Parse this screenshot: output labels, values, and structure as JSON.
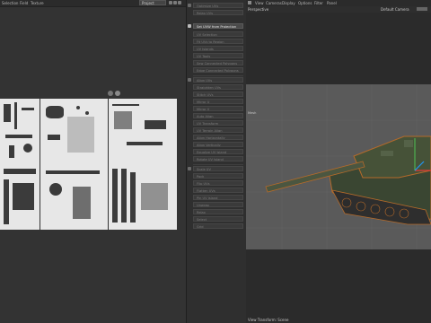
{
  "uv_editor": {
    "menu": [
      "Selection",
      "Field",
      "Texture"
    ],
    "mode_select": "Project"
  },
  "commands": {
    "items": [
      "Optimize UVs",
      "Relax UVs",
      "Set UVW from Projection",
      "UV Selection",
      "Fit UVs to Region",
      "UV Islands",
      "UV Tools",
      "Sew Connected Polygons",
      "Edge Connected Polygons",
      "Align UVs",
      "Straighten UVs",
      "Stitch UVs",
      "Mirror U",
      "Mirror V",
      "Auto Align",
      "UV Transform",
      "UV Terrain Align",
      "Align Horizontally",
      "Align Vertically",
      "Equalize UV Island",
      "Rotate UV Island",
      "Scale UV",
      "Pack",
      "Flip UVs",
      "Flatten UVs",
      "Pin UV Island",
      "Unwrap",
      "Relax",
      "Select",
      "Grid"
    ],
    "active_index": 2
  },
  "viewport": {
    "menu": [
      "View",
      "Cameras",
      "Display",
      "Options",
      "Filter",
      "Panel"
    ],
    "view_name": "Perspective",
    "camera": "Default Camera",
    "status": "View Transform: Scene",
    "label": "Mesh"
  }
}
